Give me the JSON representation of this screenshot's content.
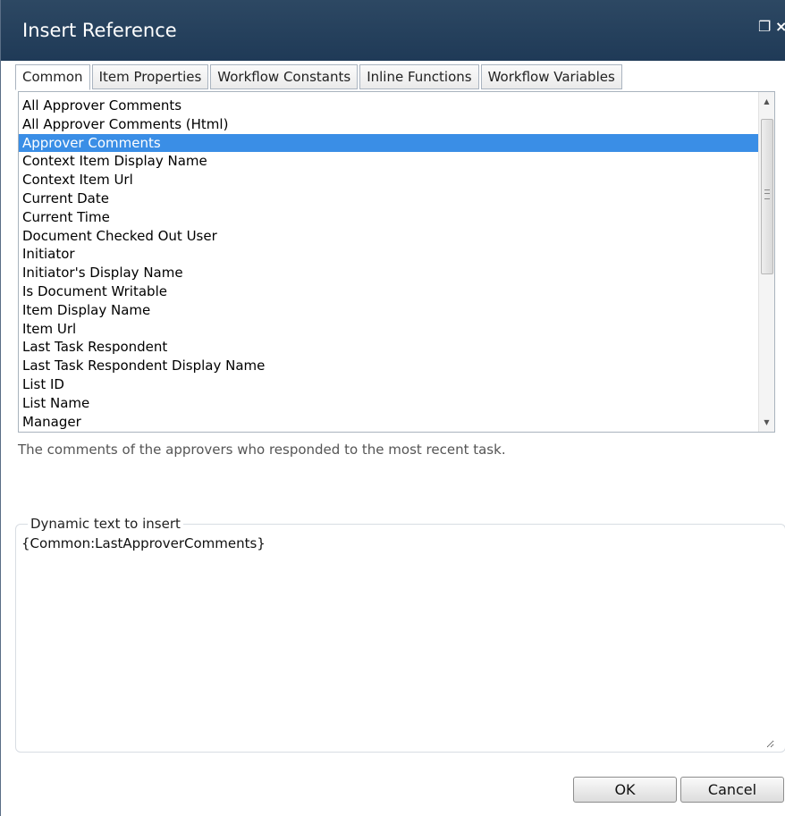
{
  "window": {
    "title": "Insert Reference",
    "restore_icon": "❐",
    "close_icon": "×"
  },
  "tabs": [
    {
      "label": "Common",
      "active": true
    },
    {
      "label": "Item Properties",
      "active": false
    },
    {
      "label": "Workflow Constants",
      "active": false
    },
    {
      "label": "Inline Functions",
      "active": false
    },
    {
      "label": "Workflow Variables",
      "active": false
    }
  ],
  "list": {
    "items": [
      "All Approver Comments",
      "All Approver Comments (Html)",
      "Approver Comments",
      "Context Item Display Name",
      "Context Item Url",
      "Current Date",
      "Current Time",
      "Document Checked Out User",
      "Initiator",
      "Initiator's Display Name",
      "Is Document Writable",
      "Item Display Name",
      "Item Url",
      "Last Task Respondent",
      "Last Task Respondent Display Name",
      "List ID",
      "List Name",
      "Manager"
    ],
    "selected_index": 2,
    "selected_color": "#3a8ee6"
  },
  "description": "The comments of the approvers who responded to the most recent task.",
  "insert": {
    "legend": "Dynamic text to insert",
    "value": "{Common:LastApproverComments}"
  },
  "buttons": {
    "ok": "OK",
    "cancel": "Cancel"
  }
}
